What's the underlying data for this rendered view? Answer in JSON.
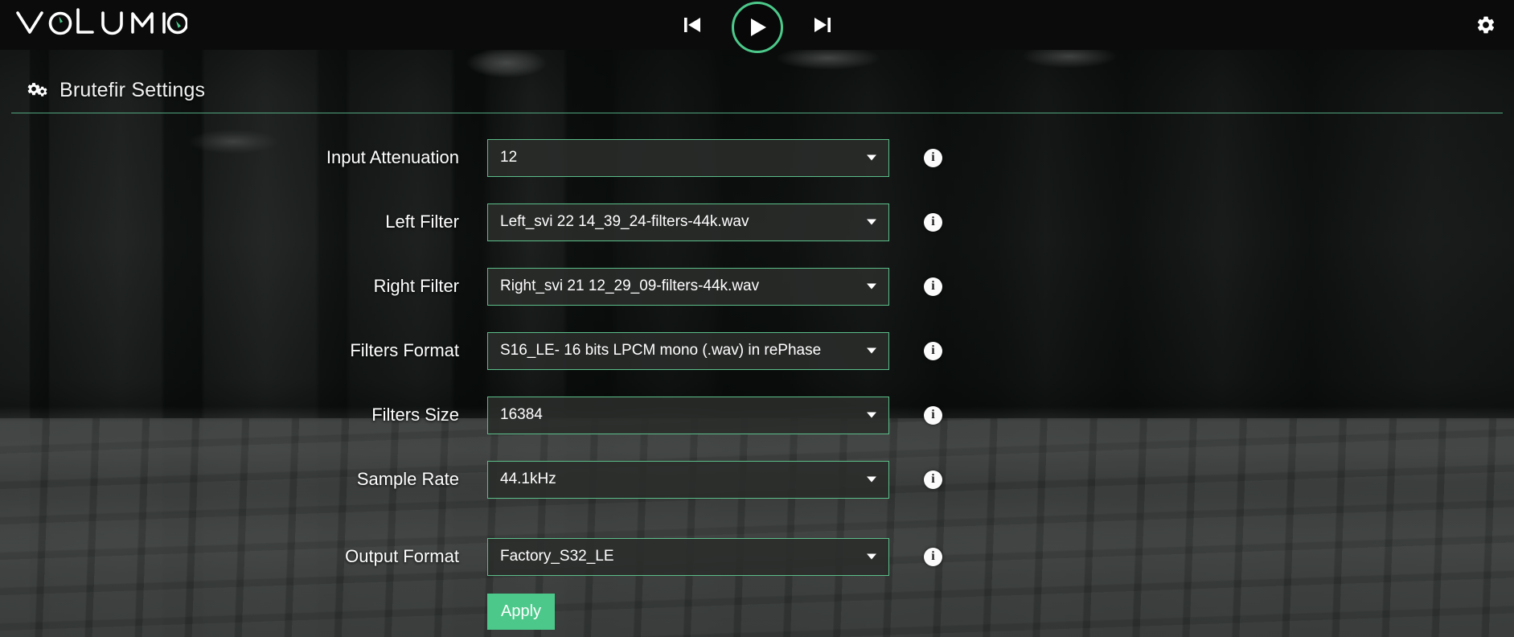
{
  "brand": {
    "logo_text": "volumio",
    "accent_color": "#4cc98a"
  },
  "topbar": {
    "prev_icon": "skip-previous-icon",
    "play_icon": "play-icon",
    "next_icon": "skip-next-icon",
    "settings_icon": "gear-icon"
  },
  "header": {
    "icon": "cogs-icon",
    "title": "Brutefir Settings"
  },
  "form": {
    "rows": [
      {
        "label": "Input Attenuation",
        "value": "12",
        "info": "i"
      },
      {
        "label": "Left Filter",
        "value": "Left_svi 22 14_39_24-filters-44k.wav",
        "info": "i"
      },
      {
        "label": "Right Filter",
        "value": "Right_svi 21 12_29_09-filters-44k.wav",
        "info": "i"
      },
      {
        "label": "Filters Format",
        "value": "S16_LE- 16 bits LPCM mono (.wav) in rePhase",
        "info": "i"
      },
      {
        "label": "Filters Size",
        "value": "16384",
        "info": "i"
      },
      {
        "label": "Sample Rate",
        "value": "44.1kHz",
        "info": "i"
      },
      {
        "label": "Output Format",
        "value": "Factory_S32_LE",
        "info": "i"
      }
    ],
    "apply_label": "Apply"
  },
  "colors": {
    "accent_green": "#4cc98a",
    "border_green": "#5cbf8a",
    "select_bg": "#2a2c2a",
    "text_white": "#ffffff"
  }
}
